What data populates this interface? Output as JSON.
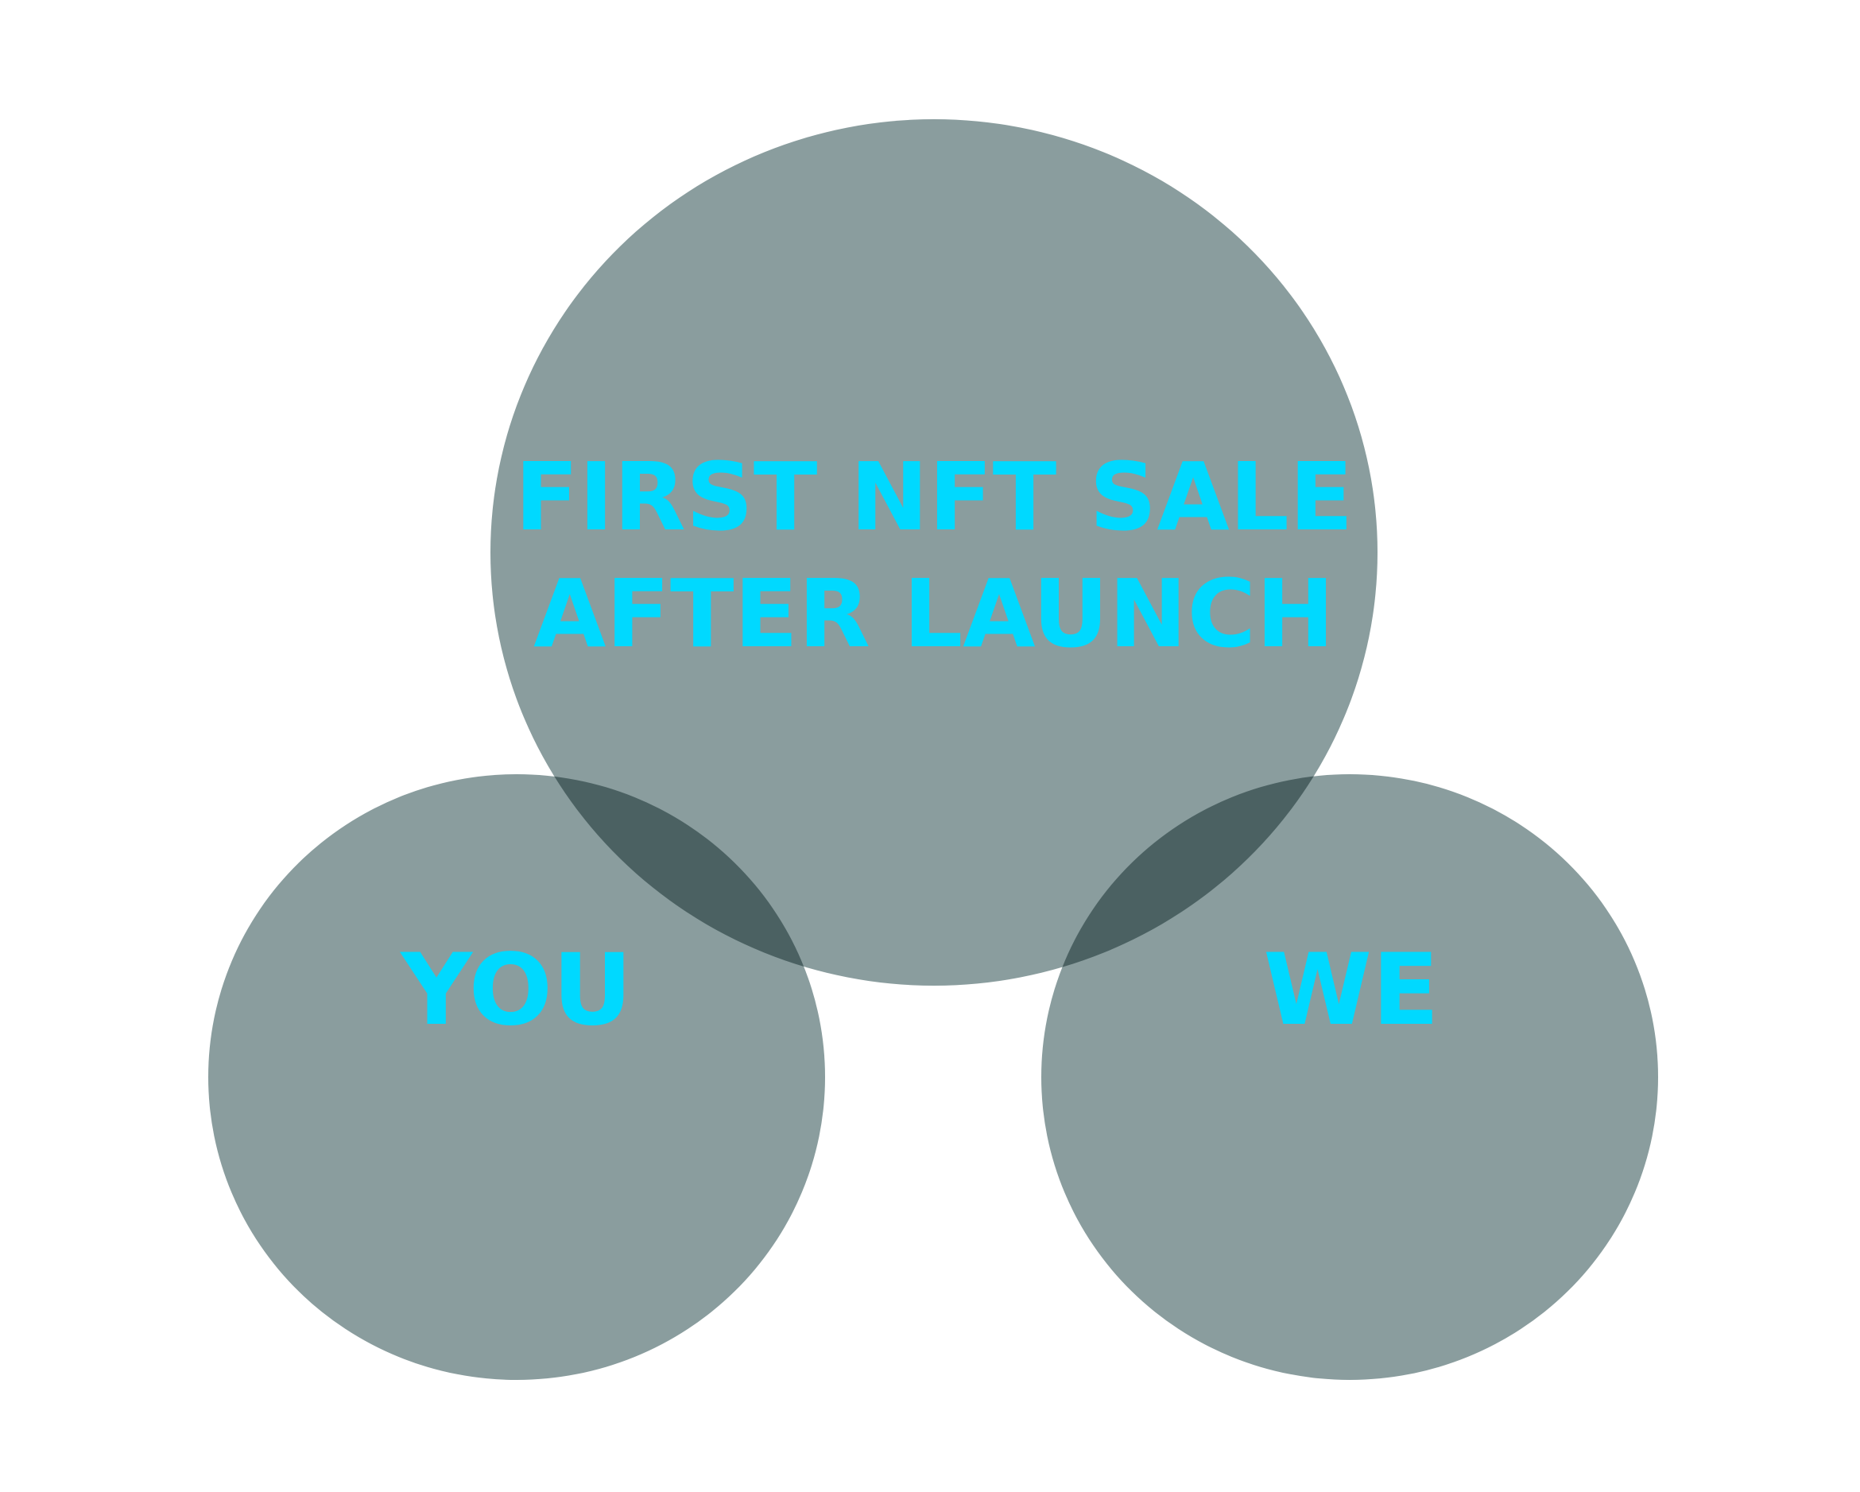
{
  "diagram": {
    "type": "venn",
    "colors": {
      "circle_fill": "#8a9d9e",
      "overlap_fill": "#506a6e",
      "label_color": "#00d9ff",
      "background": "#ffffff"
    },
    "circles": [
      {
        "id": "top",
        "lines": [
          "FIRST NFT SALE",
          "AFTER LAUNCH"
        ]
      },
      {
        "id": "left",
        "lines": [
          "YOU"
        ]
      },
      {
        "id": "right",
        "lines": [
          "WE"
        ]
      }
    ]
  }
}
